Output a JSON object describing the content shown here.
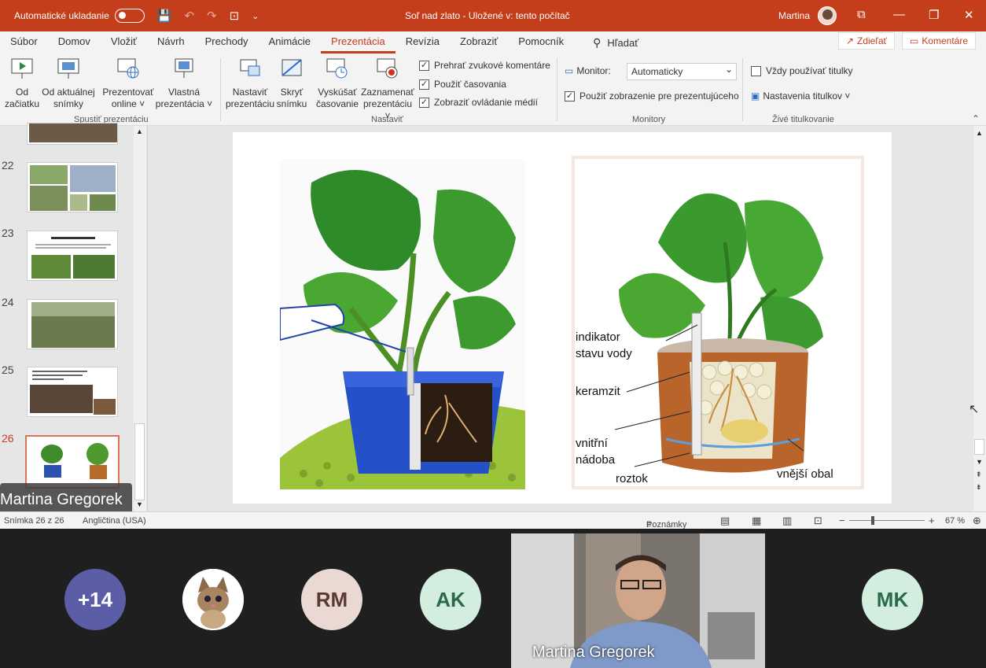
{
  "titlebar": {
    "autosave_label": "Automatické ukladanie",
    "doc_title": "Soľ nad zlato  -  Uložené v: tento počítač",
    "user_name": "Martina"
  },
  "tabs": [
    "Súbor",
    "Domov",
    "Vložiť",
    "Návrh",
    "Prechody",
    "Animácie",
    "Prezentácia",
    "Revízia",
    "Zobraziť",
    "Pomocník"
  ],
  "active_tab": "Prezentácia",
  "search_label": "Hľadať",
  "share_label": "Zdieľať",
  "comments_label": "Komentáre",
  "ribbon": {
    "start": {
      "from_start": [
        "Od",
        "začiatku"
      ],
      "from_current": [
        "Od aktuálnej",
        "snímky"
      ],
      "present_online": [
        "Prezentovať",
        "online ˅"
      ],
      "custom_show": [
        "Vlastná",
        "prezentácia ˅"
      ],
      "group": "Spustiť prezentáciu"
    },
    "setup": {
      "setup_show": [
        "Nastaviť",
        "prezentáciu"
      ],
      "hide_slide": [
        "Skryť",
        "snímku"
      ],
      "rehearse": [
        "Vyskúšať",
        "časovanie"
      ],
      "record": [
        "Zaznamenať",
        "prezentáciu ˅"
      ],
      "play_narrations": "Prehrať zvukové komentáre",
      "use_timings": "Použiť časovania",
      "show_media_controls": "Zobraziť ovládanie médií",
      "group": "Nastaviť"
    },
    "monitors": {
      "monitor_label": "Monitor:",
      "monitor_value": "Automaticky",
      "presenter_view": "Použiť zobrazenie pre prezentujúceho",
      "group": "Monitory"
    },
    "captions": {
      "always_subtitles": "Vždy používať titulky",
      "caption_settings": "Nastavenia titulkov ˅",
      "group": "Živé titulkovanie"
    }
  },
  "thumbnails": [
    {
      "num": "22"
    },
    {
      "num": "23"
    },
    {
      "num": "24"
    },
    {
      "num": "25"
    },
    {
      "num": "26"
    }
  ],
  "slide_labels": {
    "indicator": [
      "indikator",
      "stavu vody"
    ],
    "keramzit": "keramzit",
    "inner": [
      "vnitřní",
      "nádoba"
    ],
    "solution": "roztok",
    "outer": "vnější obal"
  },
  "status": {
    "slide_count": "Snímka 26 z 26",
    "language": "Angličtina (USA)",
    "notes": "Poznámky",
    "zoom": "67 %"
  },
  "participants": {
    "more": "+14",
    "rm": "RM",
    "ak": "AK",
    "mk": "MK",
    "presenter_tag": "Martina Gregorek",
    "video_name": "Martina Gregorek"
  },
  "colors": {
    "accent": "#c43e1c",
    "more_circle": "#5b5ea6",
    "rm_circle": "#ead8d2",
    "ak_circle": "#d3eddf",
    "mk_circle": "#d3eddf"
  }
}
